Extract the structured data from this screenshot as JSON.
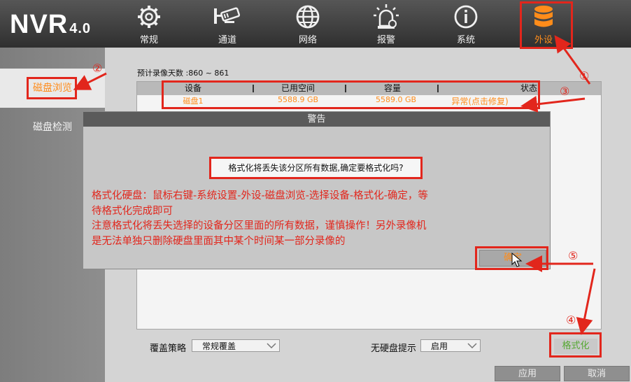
{
  "header": {
    "logo_main": "NVR",
    "logo_version": "4.0",
    "nav": [
      {
        "label": "常规",
        "icon": "gear-icon"
      },
      {
        "label": "通道",
        "icon": "camera-icon"
      },
      {
        "label": "网络",
        "icon": "globe-icon"
      },
      {
        "label": "报警",
        "icon": "alarm-icon"
      },
      {
        "label": "系统",
        "icon": "info-icon"
      },
      {
        "label": "外设",
        "icon": "database-icon"
      }
    ]
  },
  "sidebar": {
    "items": [
      {
        "label": "磁盘浏览"
      },
      {
        "label": "磁盘检测"
      }
    ]
  },
  "main": {
    "estimate": "预计录像天数 :860 ~ 861",
    "table": {
      "columns": [
        "设备",
        "已用空间",
        "容量",
        "状态"
      ],
      "rows": [
        {
          "device": "磁盘1",
          "used": "5588.9 GB",
          "capacity": "5589.0 GB",
          "status": "异常(点击修复)"
        }
      ]
    },
    "overwrite_label": "覆盖策略",
    "overwrite_value": "常规覆盖",
    "nodisk_label": "无硬盘提示",
    "nodisk_value": "启用",
    "format_button": "格式化",
    "apply_button": "应用",
    "cancel_button": "取消"
  },
  "dialog": {
    "title": "警告",
    "message": "格式化将丢失该分区所有数据,确定要格式化吗?",
    "confirm_button": "确定"
  },
  "annotation": {
    "note_lines": [
      "格式化硬盘：鼠标右键-系统设置-外设-磁盘浏览-选择设备-格式化-确定，等",
      "待格式化完成即可",
      "注意格式化将丢失选择的设备分区里面的所有数据，谨慎操作！另外录像机",
      "是无法单独只删除硬盘里面其中某个时间某一部分录像的"
    ],
    "markers": [
      "①",
      "②",
      "③",
      "④",
      "⑤"
    ],
    "accent_color": "#e2261c",
    "highlight_color": "#ff8c1a"
  }
}
